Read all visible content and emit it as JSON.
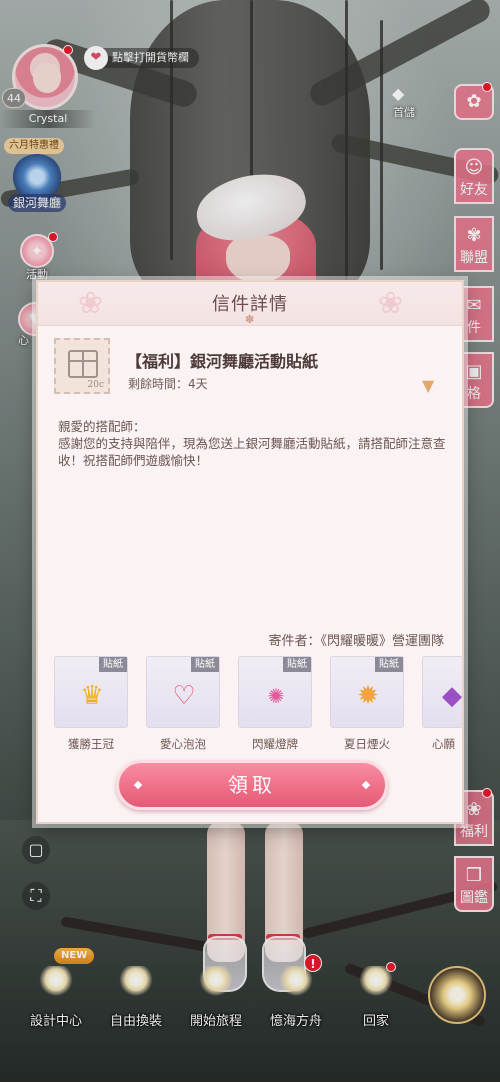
{
  "profile": {
    "level": "44",
    "name": "Crystal"
  },
  "shop_hint": "點擊打開貨幣欄",
  "promo": {
    "tag": "六月特惠禮",
    "label": "銀河舞廳"
  },
  "left_menu": {
    "activity": "活動",
    "heart_partial": "心"
  },
  "top_right": {
    "recharge_label": "首儲"
  },
  "right_menu": {
    "friends": "好友",
    "alliance": "聯盟",
    "mail_partial": "件",
    "style_partial": "格",
    "welfare": "福利",
    "gallery": "圖鑑"
  },
  "modal": {
    "title": "信件詳情",
    "subject": "【福利】銀河舞廳活動貼紙",
    "remaining": "剩餘時間：4天",
    "stamp_value": "20c",
    "greeting": "親愛的搭配師：",
    "body": "感謝您的支持與陪伴，現為您送上銀河舞廳活動貼紙，請搭配師注意查收！祝搭配師們遊戲愉快！",
    "sender": "寄件者：《閃耀暖暖》營運團隊",
    "claim_label": "領取",
    "rewards": [
      {
        "name": "獲勝王冠",
        "tag": "貼紙",
        "icon": "crown-icon"
      },
      {
        "name": "愛心泡泡",
        "tag": "貼紙",
        "icon": "heart-bubble-icon"
      },
      {
        "name": "閃耀燈牌",
        "tag": "貼紙",
        "icon": "light-sign-icon"
      },
      {
        "name": "夏日煙火",
        "tag": "貼紙",
        "icon": "firework-icon"
      },
      {
        "name": "心願",
        "tag": "",
        "icon": "purple-gem-icon"
      }
    ]
  },
  "bottom_nav": {
    "new_badge": "NEW",
    "items": [
      {
        "label": "設計中心"
      },
      {
        "label": "自由換裝"
      },
      {
        "label": "開始旅程"
      },
      {
        "label": "憶海方舟"
      },
      {
        "label": "回家"
      }
    ]
  },
  "colors": {
    "accent": "#ee6f88",
    "modal_bg": "#fbf3f3",
    "alert": "#e8192c"
  }
}
